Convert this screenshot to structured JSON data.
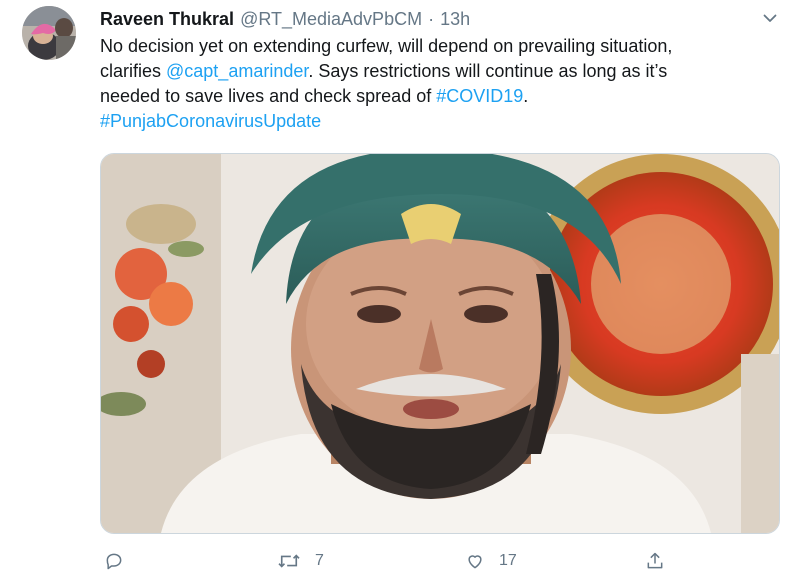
{
  "tweet": {
    "author_name": "Raveen Thukral",
    "author_handle": "@RT_MediaAdvPbCM",
    "separator": "·",
    "time": "13h",
    "text": {
      "line1": "No decision yet on extending curfew, will depend on prevailing situation,",
      "line2_pre": "clarifies ",
      "mention": "@capt_amarinder",
      "line2_post": ". Says restrictions will continue as long as it’s",
      "line3_pre": "needed to save lives and check spread of ",
      "hashtag1": "#COVID19",
      "line3_post": ".",
      "hashtag2": "#PunjabCoronavirusUpdate"
    },
    "actions": {
      "reply_icon": "reply-icon",
      "retweet_icon": "retweet-icon",
      "retweet_count": "7",
      "like_icon": "heart-icon",
      "like_count": "17",
      "share_icon": "share-icon"
    },
    "colors": {
      "link": "#1da1f2",
      "secondary": "#657786",
      "text": "#14171a"
    }
  }
}
